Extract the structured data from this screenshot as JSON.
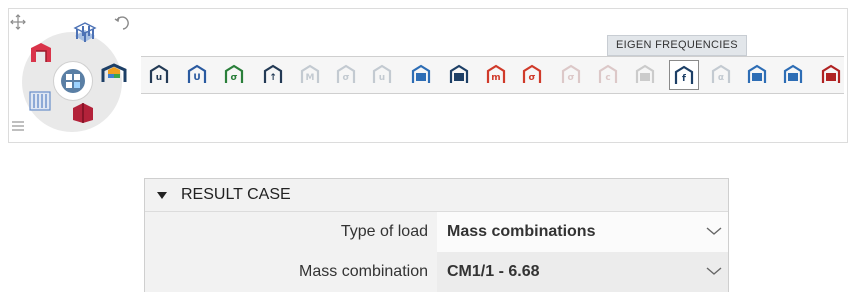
{
  "toolbar": {
    "tooltip": "EIGEN FREQUENCIES",
    "wheel": {
      "icons": [
        "frame-structure-icon",
        "building-model-icon",
        "display-options-icon",
        "colored-model-icon",
        "load-cases-icon",
        "section-cut-icon",
        "result-grid-icon"
      ]
    },
    "tools": [
      {
        "name": "deformation-u-icon",
        "glyph": "u",
        "color": "#233a55",
        "dim": false
      },
      {
        "name": "deformation-u-colored-icon",
        "glyph": "U",
        "color": "#2a5aa0",
        "dim": false
      },
      {
        "name": "stress-sigma-frame-icon",
        "glyph": "σ",
        "color": "#2a7f3a",
        "dim": false
      },
      {
        "name": "support-reaction-icon",
        "glyph": "↑",
        "color": "#233a55",
        "dim": false
      },
      {
        "name": "internal-force-m-icon",
        "glyph": "M",
        "color": "#9aa7b3",
        "dim": true
      },
      {
        "name": "internal-stress-sigma-icon",
        "glyph": "σ",
        "color": "#9aa7b3",
        "dim": true
      },
      {
        "name": "beam-deformation-icon",
        "glyph": "u",
        "color": "#9aa7b3",
        "dim": true
      },
      {
        "name": "surface-result-icon",
        "glyph": "",
        "color": "#2d6db5",
        "dim": false
      },
      {
        "name": "solid-result-icon",
        "glyph": "",
        "color": "#1d3f66",
        "dim": false
      },
      {
        "name": "surface-m-contour-icon",
        "glyph": "m",
        "color": "#d03a2a",
        "dim": false
      },
      {
        "name": "surface-sigma-contour-icon",
        "glyph": "σ",
        "color": "#d03a2a",
        "dim": false
      },
      {
        "name": "surface-dim-result-icon",
        "glyph": "σ",
        "color": "#c7a3a3",
        "dim": true
      },
      {
        "name": "surface-dim-c-icon",
        "glyph": "c",
        "color": "#c7a3a3",
        "dim": true
      },
      {
        "name": "mesh-result-icon",
        "glyph": "",
        "color": "#a9a9a9",
        "dim": true
      },
      {
        "name": "eigen-frequencies-icon",
        "glyph": "f",
        "color": "#1d3f66",
        "dim": false,
        "active": true
      },
      {
        "name": "eigen-alpha-icon",
        "glyph": "α",
        "color": "#9aa7b3",
        "dim": true
      },
      {
        "name": "result-table-icon",
        "glyph": "",
        "color": "#2d6db5",
        "dim": false
      },
      {
        "name": "result-table-node-icon",
        "glyph": "",
        "color": "#2d6db5",
        "dim": false
      },
      {
        "name": "building-drift-icon",
        "glyph": "",
        "color": "#b02222",
        "dim": false
      }
    ]
  },
  "panel": {
    "header": "RESULT CASE",
    "rows": [
      {
        "label": "Type of load",
        "value": "Mass combinations"
      },
      {
        "label": "Mass combination",
        "value": "CM1/1 - 6.68"
      }
    ]
  }
}
